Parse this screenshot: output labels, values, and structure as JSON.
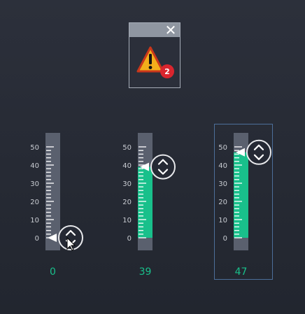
{
  "alarm": {
    "close_icon": "close-icon",
    "warning_icon": "warning-triangle-icon",
    "badge_count": "2"
  },
  "colors": {
    "background": "#262a34",
    "track": "#5a606e",
    "fill": "#19c08b",
    "tick": "#ffffff",
    "value": "#19c08b",
    "selection_border": "#4d6f9a"
  },
  "scale": {
    "min": 0,
    "max": 50,
    "labels": [
      "50",
      "40",
      "30",
      "20",
      "10",
      "0"
    ]
  },
  "sliders": [
    {
      "value": 0,
      "display": "0",
      "selected": false
    },
    {
      "value": 39,
      "display": "39",
      "selected": false
    },
    {
      "value": 47,
      "display": "47",
      "selected": true
    }
  ]
}
